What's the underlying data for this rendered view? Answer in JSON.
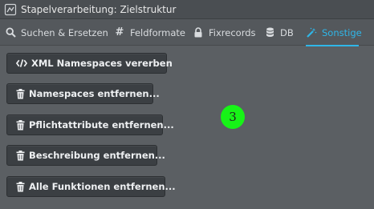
{
  "window": {
    "title": "Stapelverarbeitung: Zielstruktur",
    "icon": "app-window-icon"
  },
  "tabs": [
    {
      "label": "Suchen & Ersetzen",
      "icon": "search-icon",
      "active": false
    },
    {
      "label": "Feldformate",
      "icon": "hash-icon",
      "active": false
    },
    {
      "label": "Fixrecords",
      "icon": "lock-icon",
      "active": false
    },
    {
      "label": "DB",
      "icon": "database-icon",
      "active": false
    },
    {
      "label": "Sonstige",
      "icon": "magic-wand-icon",
      "active": true
    }
  ],
  "actions": [
    {
      "label": "XML Namespaces vererben",
      "icon": "code-icon"
    },
    {
      "label": "Namespaces entfernen...",
      "icon": "trash-icon"
    },
    {
      "label": "Pflichtattribute entfernen...",
      "icon": "trash-icon"
    },
    {
      "label": "Beschreibung entfernen...",
      "icon": "trash-icon"
    },
    {
      "label": "Alle Funktionen entfernen...",
      "icon": "trash-icon"
    }
  ],
  "step_marker": {
    "number": "3"
  },
  "colors": {
    "accent": "#2fb6e8",
    "background": "#5b5f63",
    "button": "#3b3f43",
    "marker": "#17f317"
  }
}
